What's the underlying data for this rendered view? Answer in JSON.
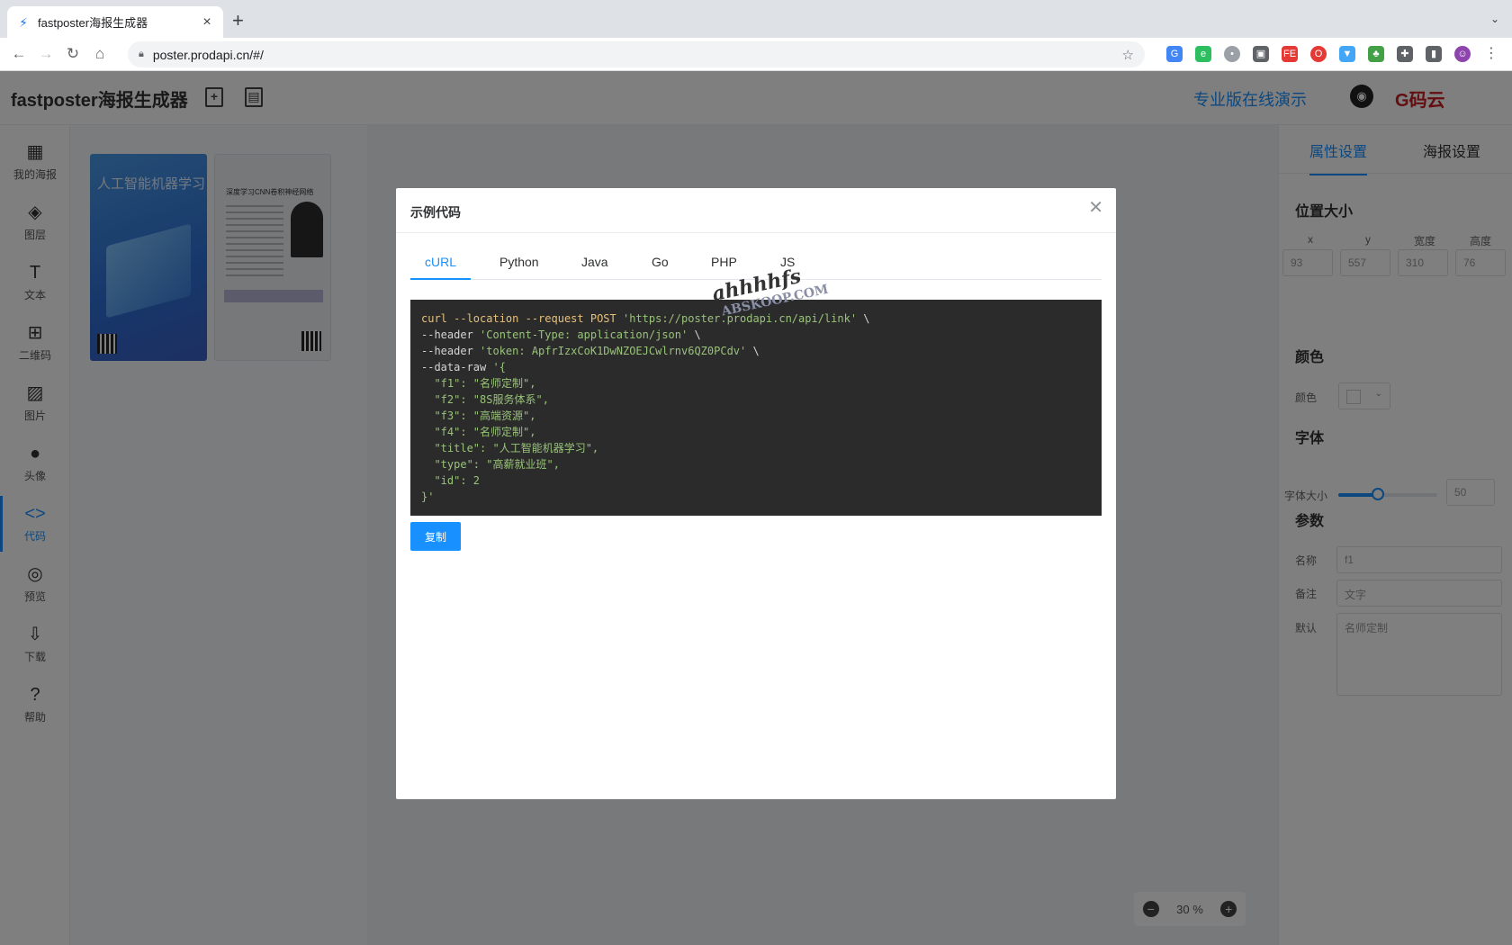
{
  "browser": {
    "tab_title": "fastposter海报生成器",
    "url": "poster.prodapi.cn/#/"
  },
  "app": {
    "brand": "fastposter海报生成器",
    "pro_link": "专业版在线演示",
    "gitee": "码云"
  },
  "leftbar": [
    {
      "label": "我的海报",
      "icon": "layout-icon"
    },
    {
      "label": "图层",
      "icon": "layers-icon"
    },
    {
      "label": "文本",
      "icon": "text-icon"
    },
    {
      "label": "二维码",
      "icon": "qrcode-icon"
    },
    {
      "label": "图片",
      "icon": "image-icon"
    },
    {
      "label": "头像",
      "icon": "avatar-icon"
    },
    {
      "label": "代码",
      "icon": "code-icon"
    },
    {
      "label": "预览",
      "icon": "eye-icon"
    },
    {
      "label": "下载",
      "icon": "download-icon"
    },
    {
      "label": "帮助",
      "icon": "help-icon"
    }
  ],
  "gallery": {
    "poster1_title": "人工智能机器学习",
    "poster2_title": "深度学习CNN卷积神经网络"
  },
  "canvas": {
    "zoom": "30 %"
  },
  "rightpanel": {
    "tabs": [
      "属性设置",
      "海报设置"
    ],
    "section_position": "位置大小",
    "pos_labels": [
      "x",
      "y",
      "宽度",
      "高度"
    ],
    "pos_values": [
      "93",
      "557",
      "310",
      "76"
    ],
    "section_color": "颜色",
    "color_label": "颜色",
    "section_font": "字体",
    "font_size_label": "字体大小",
    "font_size_value": "50",
    "font_size_fraction": 0.4,
    "section_params": "参数",
    "name_label": "名称",
    "name_value": "f1",
    "note_label": "备注",
    "note_value": "文字",
    "default_label": "默认",
    "default_value": "名师定制"
  },
  "modal": {
    "title": "示例代码",
    "tabs": [
      "cURL",
      "Python",
      "Java",
      "Go",
      "PHP",
      "JS"
    ],
    "active_tab": "cURL",
    "code": {
      "l1a": "curl --location --request POST ",
      "l1b": "'https://poster.prodapi.cn/api/link'",
      "l1c": " \\",
      "l2a": "--header ",
      "l2b": "'Content-Type: application/json'",
      "l2c": " \\",
      "l3a": "--header ",
      "l3b": "'token: ApfrIzxCoK1DwNZOEJCwlrnv6QZ0PCdv'",
      "l3c": " \\",
      "l4a": "--data-raw ",
      "l4b": "'{",
      "l5": "  \"f1\": \"名师定制\",",
      "l6": "  \"f2\": \"8S服务体系\",",
      "l7": "  \"f3\": \"高端资源\",",
      "l8": "  \"f4\": \"名师定制\",",
      "l9": "  \"title\": \"人工智能机器学习\",",
      "l10": "  \"type\": \"高薪就业班\",",
      "l11": "  \"id\": 2",
      "l12": "}'"
    },
    "copy_label": "复制"
  },
  "watermark": {
    "main": "ahhhhfs",
    "sub": "ABSKOOP.COM"
  }
}
